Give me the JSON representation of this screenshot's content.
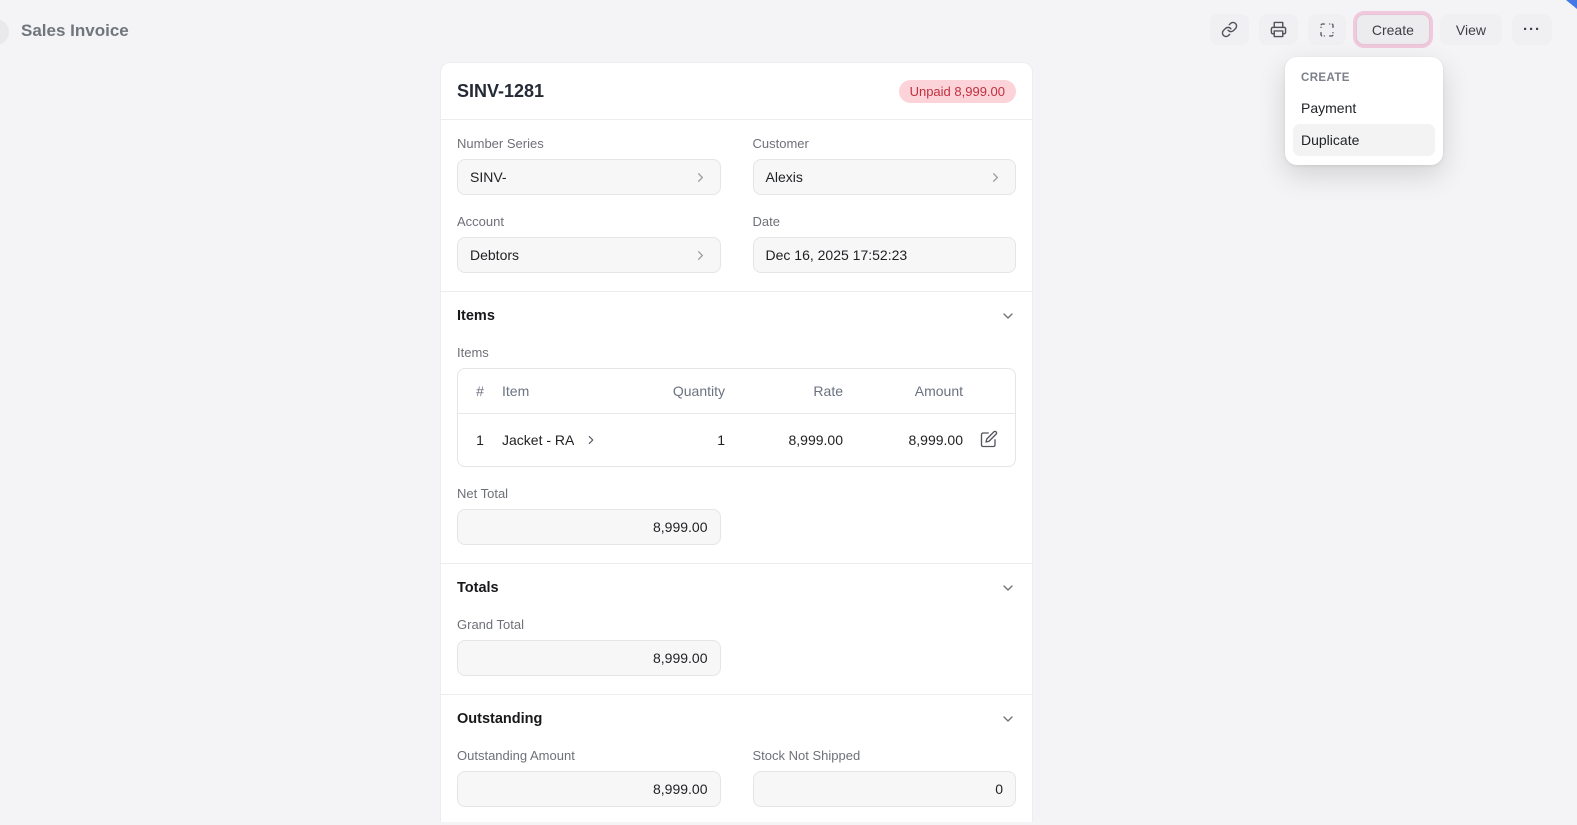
{
  "page": {
    "title": "Sales Invoice"
  },
  "toolbar": {
    "icons": [
      "link-icon",
      "print-icon",
      "fullscreen-icon"
    ],
    "create_label": "Create",
    "view_label": "View",
    "more_label": "···"
  },
  "dropdown": {
    "header": "CREATE",
    "items": [
      {
        "label": "Payment",
        "hovered": false
      },
      {
        "label": "Duplicate",
        "hovered": true
      }
    ]
  },
  "invoice": {
    "name": "SINV-1281",
    "status_badge": "Unpaid 8,999.00",
    "fields": [
      {
        "label": "Number Series",
        "value": "SINV-"
      },
      {
        "label": "Customer",
        "value": "Alexis"
      },
      {
        "label": "Account",
        "value": "Debtors"
      },
      {
        "label": "Date",
        "value": "Dec 16, 2025 17:52:23"
      }
    ],
    "items_section": {
      "title": "Items",
      "table_label": "Items",
      "columns": {
        "index": "#",
        "item": "Item",
        "quantity": "Quantity",
        "rate": "Rate",
        "amount": "Amount"
      },
      "rows": [
        {
          "index": "1",
          "item": "Jacket - RA",
          "quantity": "1",
          "rate": "8,999.00",
          "amount": "8,999.00"
        }
      ],
      "net_total_label": "Net Total",
      "net_total_value": "8,999.00"
    },
    "totals_section": {
      "title": "Totals",
      "grand_total_label": "Grand Total",
      "grand_total_value": "8,999.00"
    },
    "outstanding_section": {
      "title": "Outstanding",
      "fields": [
        {
          "label": "Outstanding Amount",
          "value": "8,999.00"
        },
        {
          "label": "Stock Not Shipped",
          "value": "0"
        }
      ]
    }
  },
  "colors": {
    "page_background": "#f4f4f6",
    "badge_background": "#fbd3d8",
    "badge_text": "#c2303f",
    "focus_ring": "#f0c9dd",
    "field_background": "#f7f7f8",
    "divider": "#ededf0"
  }
}
